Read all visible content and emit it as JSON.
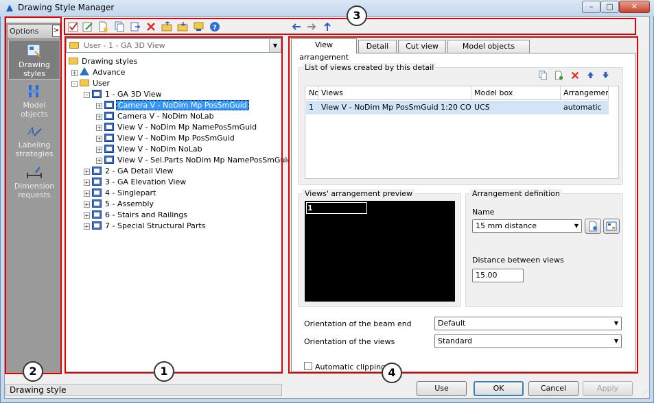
{
  "window": {
    "title": "Drawing Style Manager",
    "icon": "app-logo-icon"
  },
  "sidebar": {
    "options_label": "Options",
    "expand_glyph": ">",
    "items": [
      {
        "label": "Drawing styles",
        "icon": "drawing-styles-icon",
        "active": true
      },
      {
        "label": "Model objects",
        "icon": "model-objects-icon",
        "active": false
      },
      {
        "label": "Labeling strategies",
        "icon": "labeling-strategies-icon",
        "active": false
      },
      {
        "label": "Dimension requests",
        "icon": "dimension-requests-icon",
        "active": false
      }
    ]
  },
  "toolbar": {
    "icons": [
      "check-icon",
      "edit-icon",
      "new-icon",
      "copy-icon",
      "paste-icon",
      "delete-icon",
      "open-folder-icon",
      "import-icon",
      "export-icon",
      "help-icon"
    ],
    "nav_icons": [
      "back-arrow-icon",
      "forward-arrow-icon",
      "up-arrow-icon"
    ]
  },
  "tree": {
    "combo_value": "User - 1 - GA 3D View",
    "root": "Drawing styles",
    "advance": "Advance",
    "user": "User",
    "styles": [
      {
        "label": "1 - GA 3D View",
        "expanded": true,
        "views": [
          {
            "label": "Camera V - NoDim Mp PosSmGuid",
            "selected": true
          },
          {
            "label": "Camera V - NoDim NoLab",
            "selected": false
          },
          {
            "label": "View V - NoDim Mp NamePosSmGuid",
            "selected": false
          },
          {
            "label": "View V - NoDim Mp PosSmGuid",
            "selected": false
          },
          {
            "label": "View V - NoDim NoLab",
            "selected": false
          },
          {
            "label": "View V - Sel.Parts NoDim Mp NamePosSmGuid",
            "selected": false
          }
        ]
      },
      {
        "label": "2 - GA Detail View"
      },
      {
        "label": "3 - GA Elevation View"
      },
      {
        "label": "4 - Singlepart"
      },
      {
        "label": "5 - Assembly"
      },
      {
        "label": "6 - Stairs and Railings"
      },
      {
        "label": "7 - Special Structural Parts"
      }
    ]
  },
  "tabs": [
    "View arrangement",
    "Detail title",
    "Cut view title",
    "Model objects selection"
  ],
  "views_group": {
    "title": "List of views created by this detail",
    "actions": [
      "copy-icon",
      "add-icon",
      "delete-icon",
      "move-up-icon",
      "move-down-icon"
    ],
    "headers": [
      "No",
      "Views",
      "Model box",
      "Arrangemen"
    ],
    "rows": [
      [
        "1",
        "View V - NoDim Mp PosSmGuid 1:20 CO",
        "UCS",
        "automatic"
      ]
    ]
  },
  "preview": {
    "title": "Views' arrangement preview",
    "cell_label": "1"
  },
  "arrangement": {
    "title": "Arrangement definition",
    "name_label": "Name",
    "name_value": "15 mm distance",
    "distance_label": "Distance between views",
    "distance_value": "15.00"
  },
  "orientation": {
    "beam_end_label": "Orientation of the beam end",
    "beam_end_value": "Default",
    "views_label": "Orientation of the views",
    "views_value": "Standard"
  },
  "auto_clipping_label": "Automatic clipping",
  "buttons": {
    "use": "Use",
    "ok": "OK",
    "cancel": "Cancel",
    "apply": "Apply"
  },
  "status": "Drawing style",
  "callouts": [
    "1",
    "2",
    "3",
    "4"
  ],
  "colors": {
    "selection": "#3399ff",
    "callout": "#e00000",
    "sidebar": "#9a9a9a"
  }
}
